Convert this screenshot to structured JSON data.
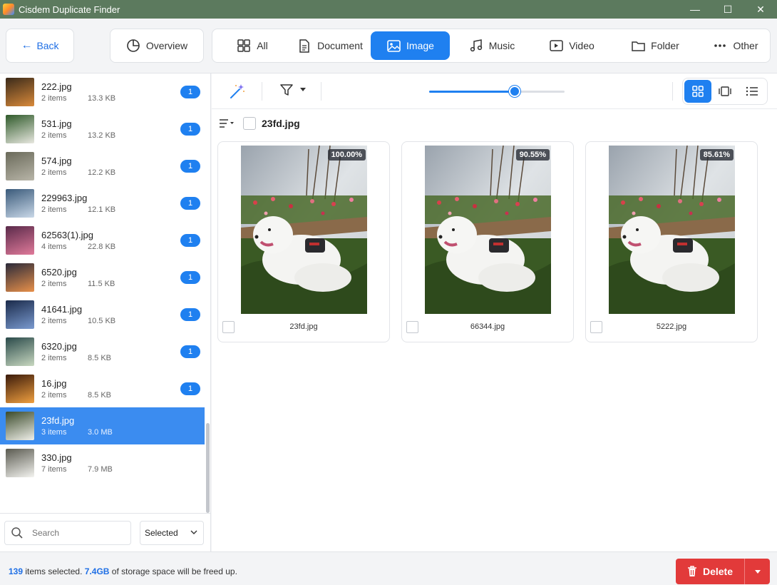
{
  "window": {
    "title": "Cisdem Duplicate Finder",
    "minimize": "—",
    "maximize": "☐",
    "close": "✕"
  },
  "toolbar": {
    "back_label": "Back",
    "overview_label": "Overview",
    "tabs": [
      {
        "label": "All",
        "icon": "grid-icon"
      },
      {
        "label": "Document",
        "icon": "document-icon"
      },
      {
        "label": "Image",
        "icon": "image-icon",
        "active": true
      },
      {
        "label": "Music",
        "icon": "music-icon"
      },
      {
        "label": "Video",
        "icon": "video-icon"
      },
      {
        "label": "Folder",
        "icon": "folder-icon"
      },
      {
        "label": "Other",
        "icon": "more-icon"
      }
    ]
  },
  "file_list": [
    {
      "name": "222.jpg",
      "count": "2 items",
      "size": "13.3 KB",
      "badge": "1",
      "thumb": [
        "#3a2a1a",
        "#d98a3a"
      ]
    },
    {
      "name": "531.jpg",
      "count": "2 items",
      "size": "13.2 KB",
      "badge": "1",
      "thumb": [
        "#2f5a2a",
        "#e8e8e0"
      ]
    },
    {
      "name": "574.jpg",
      "count": "2 items",
      "size": "12.2 KB",
      "badge": "1",
      "thumb": [
        "#6a6a5a",
        "#b8b5a8"
      ]
    },
    {
      "name": "229963.jpg",
      "count": "2 items",
      "size": "12.1 KB",
      "badge": "1",
      "thumb": [
        "#3a5a7a",
        "#c9d8e8"
      ]
    },
    {
      "name": "62563(1).jpg",
      "count": "4 items",
      "size": "22.8 KB",
      "badge": "1",
      "thumb": [
        "#5a2a4a",
        "#e07a9a"
      ]
    },
    {
      "name": "6520.jpg",
      "count": "2 items",
      "size": "11.5 KB",
      "badge": "1",
      "thumb": [
        "#2a2a3a",
        "#e8904a"
      ]
    },
    {
      "name": "41641.jpg",
      "count": "2 items",
      "size": "10.5 KB",
      "badge": "1",
      "thumb": [
        "#1a2a4a",
        "#7a9acf"
      ]
    },
    {
      "name": "6320.jpg",
      "count": "2 items",
      "size": "8.5 KB",
      "badge": "1",
      "thumb": [
        "#2a4a4a",
        "#c8d8c0"
      ]
    },
    {
      "name": "16.jpg",
      "count": "2 items",
      "size": "8.5 KB",
      "badge": "1",
      "thumb": [
        "#3a1a0a",
        "#f0a040"
      ]
    },
    {
      "name": "23fd.jpg",
      "count": "3 items",
      "size": "3.0 MB",
      "badge": "",
      "selected": true,
      "thumb": [
        "#3a4a2a",
        "#f0f0ea"
      ]
    },
    {
      "name": "330.jpg",
      "count": "7 items",
      "size": "7.9 MB",
      "badge": "",
      "thumb": [
        "#5a5a50",
        "#f4f4f0"
      ]
    }
  ],
  "search": {
    "placeholder": "Search",
    "value": ""
  },
  "filter_select": {
    "value": "Selected"
  },
  "zoom": {
    "level": 0.63
  },
  "group": {
    "name": "23fd.jpg"
  },
  "cards": [
    {
      "name": "23fd.jpg",
      "similarity": "100.00%"
    },
    {
      "name": "66344.jpg",
      "similarity": "90.55%"
    },
    {
      "name": "5222.jpg",
      "similarity": "85.61%"
    }
  ],
  "status": {
    "count": "139",
    "count_text": "items selected.",
    "size": "7.4GB",
    "size_text": "of storage space will be freed up."
  },
  "delete_label": "Delete",
  "colors": {
    "accent": "#1f80f0",
    "danger": "#e23a3a",
    "titlebar": "#5c7a5e"
  }
}
